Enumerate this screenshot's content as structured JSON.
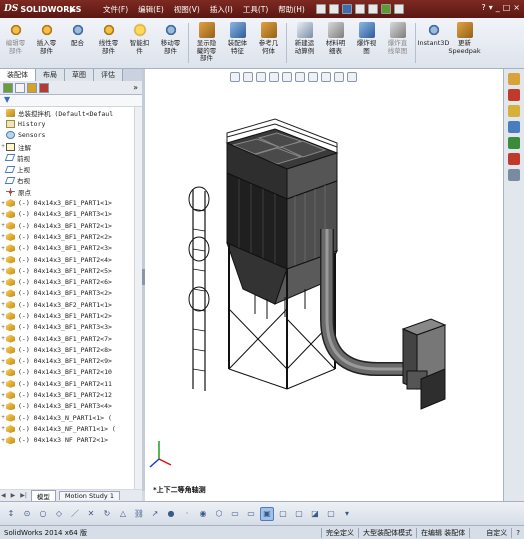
{
  "app": {
    "logo_text": "SOLIDWORKS",
    "logo_ds": "DS",
    "expander": "▶"
  },
  "menus": [
    "文件(F)",
    "编辑(E)",
    "视图(V)",
    "插入(I)",
    "工具(T)",
    "帮助(H)"
  ],
  "window_buttons": [
    "?",
    "▾",
    "_",
    "□",
    "×"
  ],
  "ribbon": [
    {
      "label": "编辑零\n部件",
      "icon": "edit-component-icon",
      "style": "gears",
      "dim": true
    },
    {
      "label": "插入零\n部件",
      "icon": "insert-component-icon",
      "style": "gears",
      "dim": false
    },
    {
      "label": "配合",
      "icon": "mate-icon",
      "style": "gears2",
      "dim": false
    },
    {
      "label": "线性零\n部件",
      "icon": "linear-pattern-icon",
      "style": "gears",
      "dim": false
    },
    {
      "label": "智能扣\n件",
      "icon": "smart-fastener-icon",
      "style": "star",
      "dim": false
    },
    {
      "label": "移动零\n部件",
      "icon": "move-component-icon",
      "style": "gears2",
      "dim": false
    },
    {
      "label": "显示隐\n藏的零\n部件",
      "icon": "show-hidden-icon",
      "style": "cube",
      "dim": false
    },
    {
      "label": "装配体\n特征",
      "icon": "assembly-feature-icon",
      "style": "cubeb",
      "dim": false
    },
    {
      "label": "参考几\n何体",
      "icon": "reference-geometry-icon",
      "style": "cube",
      "dim": false
    },
    {
      "label": "新建运\n动算例",
      "icon": "motion-study-icon",
      "style": "car",
      "dim": false
    },
    {
      "label": "材料明\n细表",
      "icon": "bom-icon",
      "style": "sq",
      "dim": false
    },
    {
      "label": "爆炸视\n图",
      "icon": "exploded-view-icon",
      "style": "cubeb",
      "dim": false
    },
    {
      "label": "爆炸直\n线草图",
      "icon": "explode-line-icon",
      "style": "sq",
      "dim": true
    },
    {
      "label": "Instant3D",
      "icon": "instant3d-icon",
      "style": "gears2",
      "dim": false
    },
    {
      "label": "更新\nSpeedpak",
      "icon": "speedpak-icon",
      "style": "cube",
      "dim": false
    }
  ],
  "command_tabs": [
    "装配体",
    "布局",
    "草图",
    "评估"
  ],
  "panel": {
    "chevron": "»",
    "filter_icon": "▼"
  },
  "tree": [
    {
      "text": "总装搅拌机  (Default<Defaul",
      "icon": "asm",
      "exp": ""
    },
    {
      "text": "History",
      "icon": "hist",
      "exp": ""
    },
    {
      "text": "Sensors",
      "icon": "sens",
      "exp": ""
    },
    {
      "text": "注解",
      "icon": "ann",
      "exp": "+"
    },
    {
      "text": "前视",
      "icon": "plane",
      "exp": ""
    },
    {
      "text": "上视",
      "icon": "plane",
      "exp": ""
    },
    {
      "text": "右视",
      "icon": "plane",
      "exp": ""
    },
    {
      "text": "原点",
      "icon": "orig",
      "exp": ""
    },
    {
      "text": "(-) 04x14x3_BF1_PART1<1>",
      "icon": "part",
      "exp": "+"
    },
    {
      "text": "(-) 04x14x3_BF1_PART3<1>",
      "icon": "part",
      "exp": "+"
    },
    {
      "text": "(-) 04x14x3_BF1_PART2<1>",
      "icon": "part",
      "exp": "+"
    },
    {
      "text": "(-) 04x14x3_BF1_PART2<2>",
      "icon": "part",
      "exp": "+"
    },
    {
      "text": "(-) 04x14x3_BF1_PART2<3>",
      "icon": "part",
      "exp": "+"
    },
    {
      "text": "(-) 04x14x3_BF1_PART2<4>",
      "icon": "part",
      "exp": "+"
    },
    {
      "text": "(-) 04x14x3_BF1_PART2<5>",
      "icon": "part",
      "exp": "+"
    },
    {
      "text": "(-) 04x14x3_BF1_PART2<6>",
      "icon": "part",
      "exp": "+"
    },
    {
      "text": "(-) 04x14x3_BF1_PART3<2>",
      "icon": "part",
      "exp": "+"
    },
    {
      "text": "(-) 04x14x3_BF2_PART1<1>",
      "icon": "part",
      "exp": "+"
    },
    {
      "text": "(-) 04x14x3_BF1_PART1<2>",
      "icon": "part",
      "exp": "+"
    },
    {
      "text": "(-) 04x14x3_BF1_PART3<3>",
      "icon": "part",
      "exp": "+"
    },
    {
      "text": "(-) 04x14x3_BF1_PART2<7>",
      "icon": "part",
      "exp": "+"
    },
    {
      "text": "(-) 04x14x3_BF1_PART2<8>",
      "icon": "part",
      "exp": "+"
    },
    {
      "text": "(-) 04x14x3_BF1_PART2<9>",
      "icon": "part",
      "exp": "+"
    },
    {
      "text": "(-) 04x14x3_BF1_PART2<10",
      "icon": "part",
      "exp": "+"
    },
    {
      "text": "(-) 04x14x3_BF1_PART2<11",
      "icon": "part",
      "exp": "+"
    },
    {
      "text": "(-) 04x14x3_BF1_PART2<12",
      "icon": "part",
      "exp": "+"
    },
    {
      "text": "(-) 04x14x3_BF1_PART3<4>",
      "icon": "part",
      "exp": "+"
    },
    {
      "text": "(-) 04x14x3_N_PART1<1> (",
      "icon": "part",
      "exp": "+"
    },
    {
      "text": "(-) 04x14x3_NF_PART1<1> (",
      "icon": "part",
      "exp": "+"
    },
    {
      "text": "(-) 04x14x3 NF PART2<1>",
      "icon": "part",
      "exp": "+"
    }
  ],
  "bottom_tabs": {
    "nav": [
      "◀",
      "▶",
      "▶|"
    ],
    "tabs": [
      "模型",
      "Motion Study 1"
    ]
  },
  "viewport": {
    "view_label": "*上下二等角轴测"
  },
  "status": {
    "version": "SolidWorks 2014 x64 版",
    "items": [
      "完全定义",
      "大型装配体模式",
      "在编辑 装配体",
      "自定义",
      "?"
    ]
  }
}
